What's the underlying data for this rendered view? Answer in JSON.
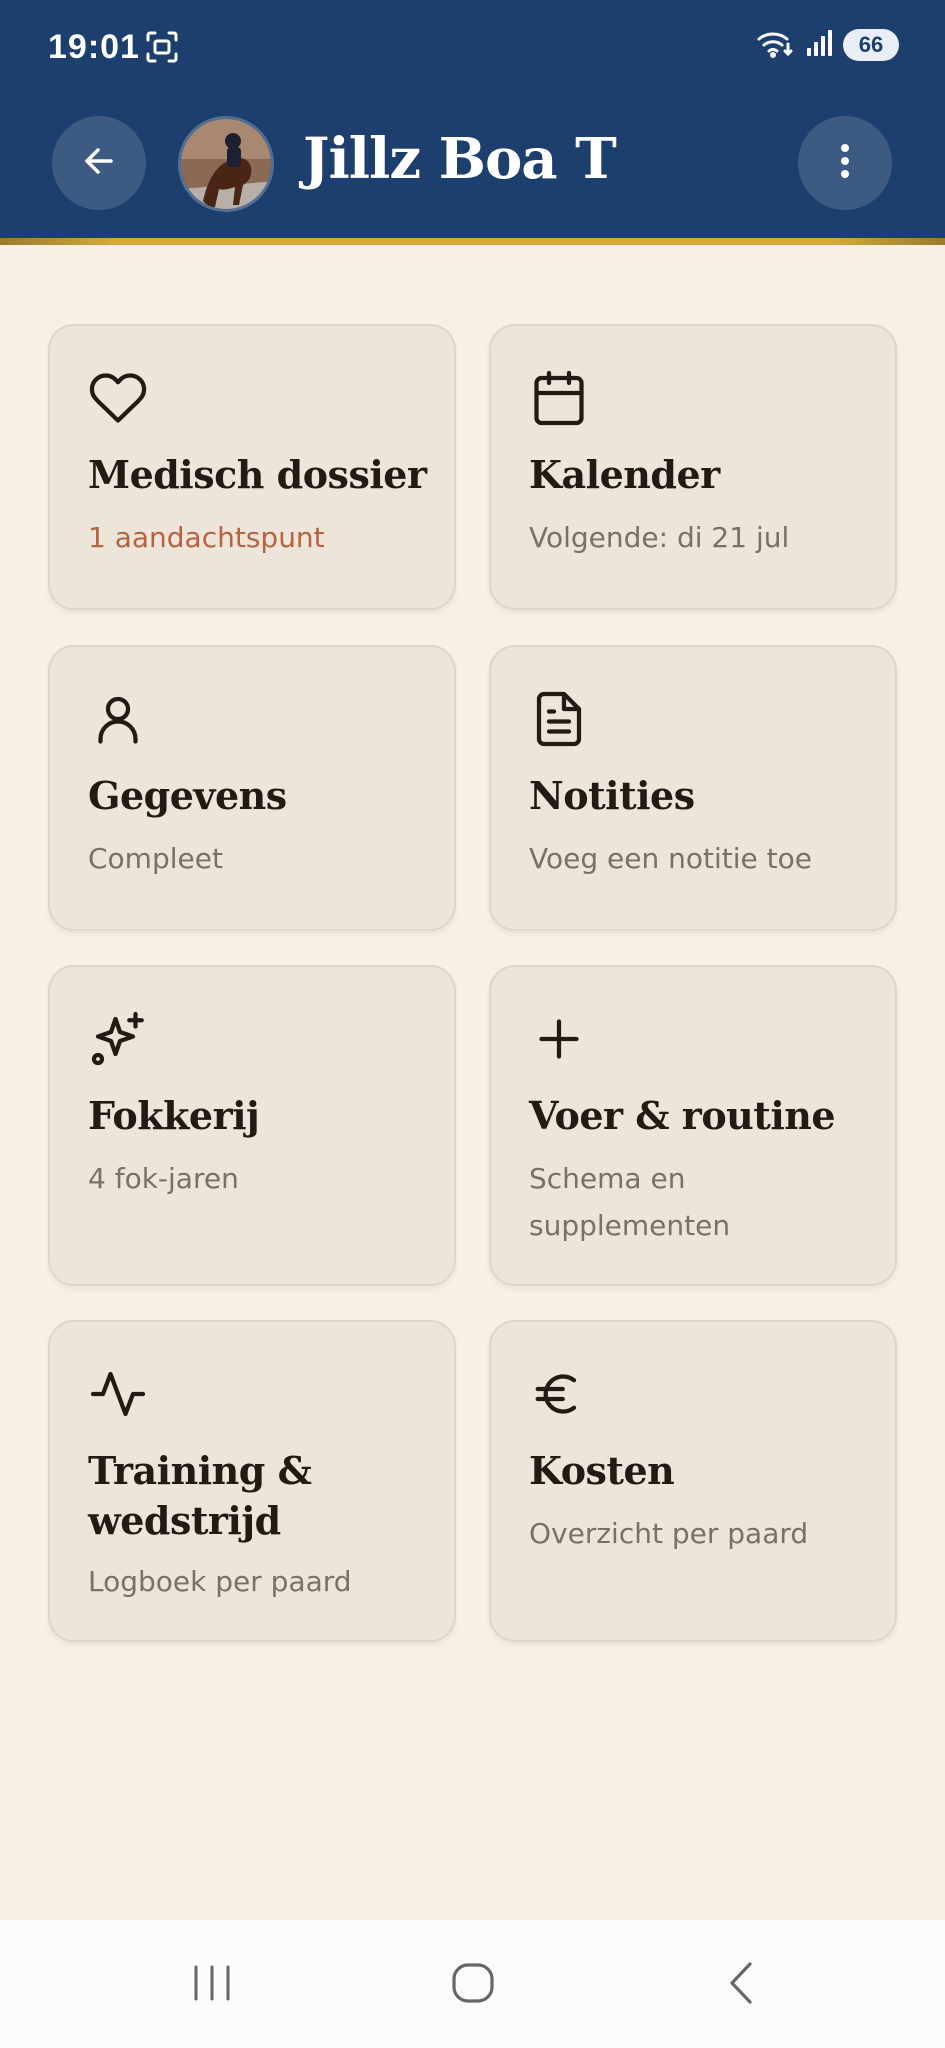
{
  "status_bar": {
    "time": "19:01",
    "battery": "66",
    "icons": [
      "screenshot-icon",
      "wifi-icon",
      "signal-icon",
      "battery-icon"
    ]
  },
  "header": {
    "title": "Jillz Boa T",
    "back_icon": "arrow-left-icon",
    "menu_icon": "more-vertical-icon",
    "background": "#1c3f6e",
    "accent_line": "#d4a838"
  },
  "cards": [
    {
      "icon": "heart-icon",
      "title": "Medisch dossier",
      "subtitle": "1 aandachtspunt"
    },
    {
      "icon": "calendar-icon",
      "title": "Kalender",
      "subtitle": "Volgende: di 21 jul"
    },
    {
      "icon": "user-icon",
      "title": "Gegevens",
      "subtitle": "Compleet"
    },
    {
      "icon": "document-icon",
      "title": "Notities",
      "subtitle": "Voeg een notitie toe"
    },
    {
      "icon": "sparkles-icon",
      "title": "Fokkerij",
      "subtitle": "4 fok-jaren"
    },
    {
      "icon": "plus-icon",
      "title": "Voer & routine",
      "subtitle": "Schema en supplementen"
    },
    {
      "icon": "activity-icon",
      "title": "Training & wedstrijd",
      "subtitle": "Logboek per paard"
    },
    {
      "icon": "euro-icon",
      "title": "Kosten",
      "subtitle": "Overzicht per paard"
    }
  ],
  "colors": {
    "page_background": "#f7f0e6",
    "card_background": "#ede5d9",
    "warning_text": "#b8633f",
    "muted_text": "#7a7068"
  },
  "navbar": {
    "icons": [
      "recent-apps-icon",
      "home-icon",
      "back-icon"
    ]
  }
}
